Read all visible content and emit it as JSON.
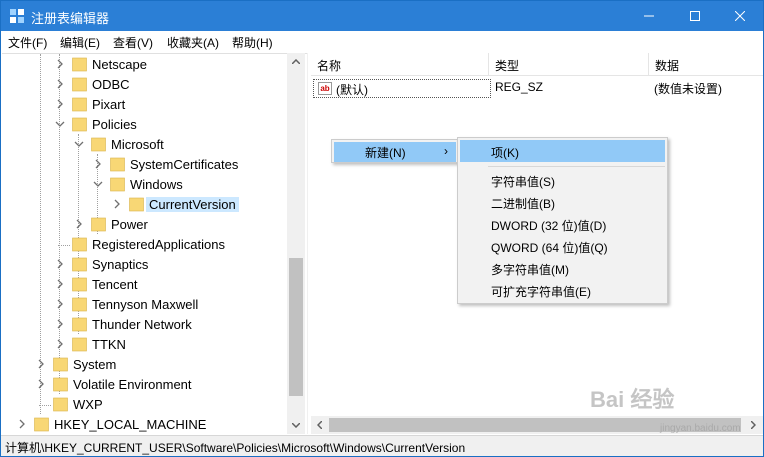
{
  "window": {
    "title": "注册表编辑器"
  },
  "menu": [
    "文件(F)",
    "编辑(E)",
    "查看(V)",
    "收藏夹(A)",
    "帮助(H)"
  ],
  "tree": [
    {
      "label": "Netscape",
      "state": "collapsed"
    },
    {
      "label": "ODBC",
      "state": "collapsed"
    },
    {
      "label": "Pixart",
      "state": "collapsed"
    },
    {
      "label": "Policies",
      "state": "expanded"
    },
    {
      "label": "Microsoft",
      "state": "expanded"
    },
    {
      "label": "SystemCertificates",
      "state": "collapsed"
    },
    {
      "label": "Windows",
      "state": "expanded"
    },
    {
      "label": "CurrentVersion",
      "state": "collapsed",
      "selected": true
    },
    {
      "label": "Power",
      "state": "collapsed"
    },
    {
      "label": "RegisteredApplications",
      "state": "leaf"
    },
    {
      "label": "Synaptics",
      "state": "collapsed"
    },
    {
      "label": "Tencent",
      "state": "collapsed"
    },
    {
      "label": "Tennyson Maxwell",
      "state": "collapsed"
    },
    {
      "label": "Thunder Network",
      "state": "collapsed"
    },
    {
      "label": "TTKN",
      "state": "collapsed"
    },
    {
      "label": "System",
      "state": "collapsed"
    },
    {
      "label": "Volatile Environment",
      "state": "collapsed"
    },
    {
      "label": "WXP",
      "state": "leaf"
    },
    {
      "label": "HKEY_LOCAL_MACHINE",
      "state": "collapsed"
    }
  ],
  "columns": {
    "name": "名称",
    "type": "类型",
    "data": "数据"
  },
  "values": [
    {
      "name": "(默认)",
      "type": "REG_SZ",
      "data": "(数值未设置)",
      "icon": "ab"
    }
  ],
  "context_menu": {
    "new_label": "新建(N)",
    "submenu": [
      "项(K)",
      "字符串值(S)",
      "二进制值(B)",
      "DWORD (32 位)值(D)",
      "QWORD (64 位)值(Q)",
      "多字符串值(M)",
      "可扩充字符串值(E)"
    ]
  },
  "status": "计算机\\HKEY_CURRENT_USER\\Software\\Policies\\Microsoft\\Windows\\CurrentVersion",
  "watermark": {
    "main": "Bai 经验",
    "sub": "jingyan.baidu.com"
  },
  "colors": {
    "titlebar": "#2b7fd6",
    "menu_highlight": "#91c9f7",
    "selection": "#cce8ff",
    "folder": "#f8d775"
  }
}
